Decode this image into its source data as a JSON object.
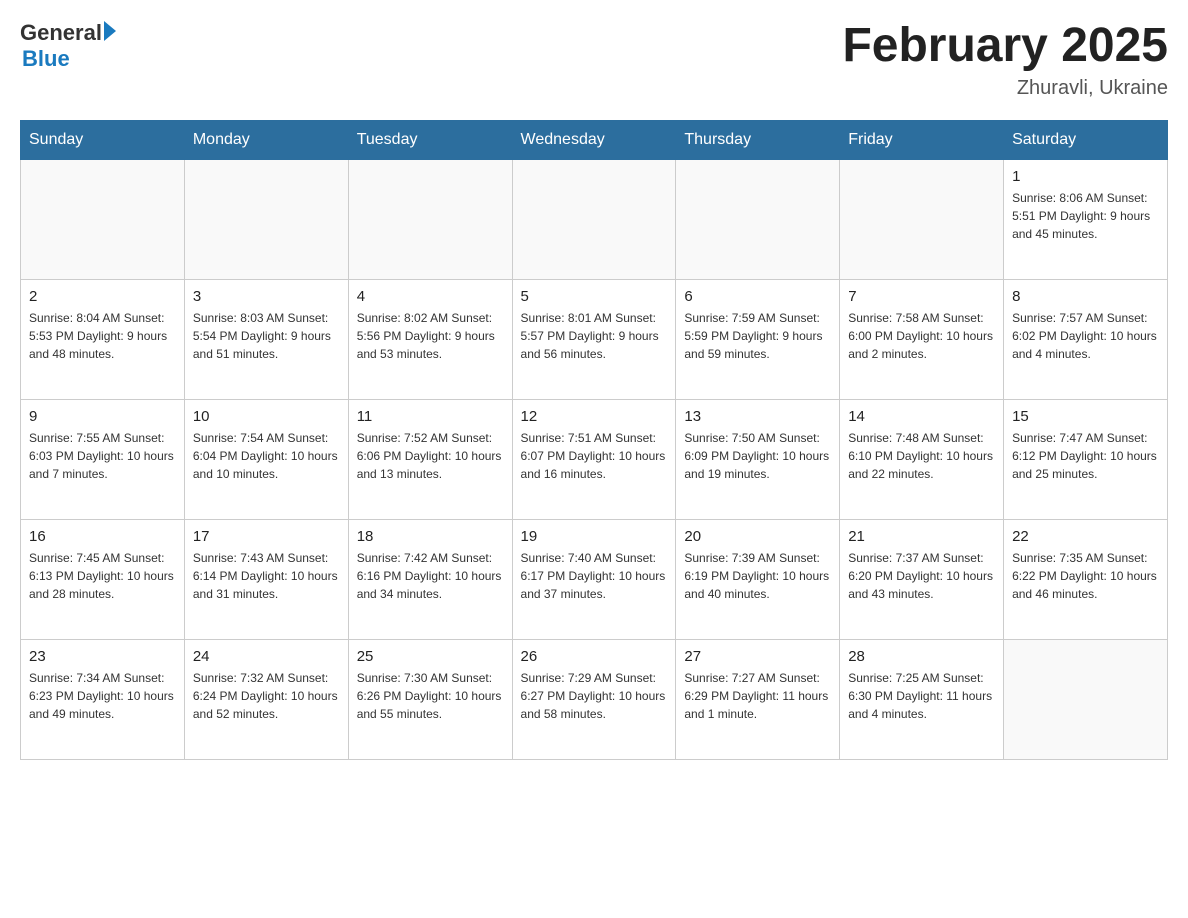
{
  "header": {
    "logo": {
      "general": "General",
      "blue": "Blue"
    },
    "title": "February 2025",
    "subtitle": "Zhuravli, Ukraine"
  },
  "weekdays": [
    "Sunday",
    "Monday",
    "Tuesday",
    "Wednesday",
    "Thursday",
    "Friday",
    "Saturday"
  ],
  "weeks": [
    [
      {
        "day": "",
        "info": ""
      },
      {
        "day": "",
        "info": ""
      },
      {
        "day": "",
        "info": ""
      },
      {
        "day": "",
        "info": ""
      },
      {
        "day": "",
        "info": ""
      },
      {
        "day": "",
        "info": ""
      },
      {
        "day": "1",
        "info": "Sunrise: 8:06 AM\nSunset: 5:51 PM\nDaylight: 9 hours\nand 45 minutes."
      }
    ],
    [
      {
        "day": "2",
        "info": "Sunrise: 8:04 AM\nSunset: 5:53 PM\nDaylight: 9 hours\nand 48 minutes."
      },
      {
        "day": "3",
        "info": "Sunrise: 8:03 AM\nSunset: 5:54 PM\nDaylight: 9 hours\nand 51 minutes."
      },
      {
        "day": "4",
        "info": "Sunrise: 8:02 AM\nSunset: 5:56 PM\nDaylight: 9 hours\nand 53 minutes."
      },
      {
        "day": "5",
        "info": "Sunrise: 8:01 AM\nSunset: 5:57 PM\nDaylight: 9 hours\nand 56 minutes."
      },
      {
        "day": "6",
        "info": "Sunrise: 7:59 AM\nSunset: 5:59 PM\nDaylight: 9 hours\nand 59 minutes."
      },
      {
        "day": "7",
        "info": "Sunrise: 7:58 AM\nSunset: 6:00 PM\nDaylight: 10 hours\nand 2 minutes."
      },
      {
        "day": "8",
        "info": "Sunrise: 7:57 AM\nSunset: 6:02 PM\nDaylight: 10 hours\nand 4 minutes."
      }
    ],
    [
      {
        "day": "9",
        "info": "Sunrise: 7:55 AM\nSunset: 6:03 PM\nDaylight: 10 hours\nand 7 minutes."
      },
      {
        "day": "10",
        "info": "Sunrise: 7:54 AM\nSunset: 6:04 PM\nDaylight: 10 hours\nand 10 minutes."
      },
      {
        "day": "11",
        "info": "Sunrise: 7:52 AM\nSunset: 6:06 PM\nDaylight: 10 hours\nand 13 minutes."
      },
      {
        "day": "12",
        "info": "Sunrise: 7:51 AM\nSunset: 6:07 PM\nDaylight: 10 hours\nand 16 minutes."
      },
      {
        "day": "13",
        "info": "Sunrise: 7:50 AM\nSunset: 6:09 PM\nDaylight: 10 hours\nand 19 minutes."
      },
      {
        "day": "14",
        "info": "Sunrise: 7:48 AM\nSunset: 6:10 PM\nDaylight: 10 hours\nand 22 minutes."
      },
      {
        "day": "15",
        "info": "Sunrise: 7:47 AM\nSunset: 6:12 PM\nDaylight: 10 hours\nand 25 minutes."
      }
    ],
    [
      {
        "day": "16",
        "info": "Sunrise: 7:45 AM\nSunset: 6:13 PM\nDaylight: 10 hours\nand 28 minutes."
      },
      {
        "day": "17",
        "info": "Sunrise: 7:43 AM\nSunset: 6:14 PM\nDaylight: 10 hours\nand 31 minutes."
      },
      {
        "day": "18",
        "info": "Sunrise: 7:42 AM\nSunset: 6:16 PM\nDaylight: 10 hours\nand 34 minutes."
      },
      {
        "day": "19",
        "info": "Sunrise: 7:40 AM\nSunset: 6:17 PM\nDaylight: 10 hours\nand 37 minutes."
      },
      {
        "day": "20",
        "info": "Sunrise: 7:39 AM\nSunset: 6:19 PM\nDaylight: 10 hours\nand 40 minutes."
      },
      {
        "day": "21",
        "info": "Sunrise: 7:37 AM\nSunset: 6:20 PM\nDaylight: 10 hours\nand 43 minutes."
      },
      {
        "day": "22",
        "info": "Sunrise: 7:35 AM\nSunset: 6:22 PM\nDaylight: 10 hours\nand 46 minutes."
      }
    ],
    [
      {
        "day": "23",
        "info": "Sunrise: 7:34 AM\nSunset: 6:23 PM\nDaylight: 10 hours\nand 49 minutes."
      },
      {
        "day": "24",
        "info": "Sunrise: 7:32 AM\nSunset: 6:24 PM\nDaylight: 10 hours\nand 52 minutes."
      },
      {
        "day": "25",
        "info": "Sunrise: 7:30 AM\nSunset: 6:26 PM\nDaylight: 10 hours\nand 55 minutes."
      },
      {
        "day": "26",
        "info": "Sunrise: 7:29 AM\nSunset: 6:27 PM\nDaylight: 10 hours\nand 58 minutes."
      },
      {
        "day": "27",
        "info": "Sunrise: 7:27 AM\nSunset: 6:29 PM\nDaylight: 11 hours\nand 1 minute."
      },
      {
        "day": "28",
        "info": "Sunrise: 7:25 AM\nSunset: 6:30 PM\nDaylight: 11 hours\nand 4 minutes."
      },
      {
        "day": "",
        "info": ""
      }
    ]
  ]
}
